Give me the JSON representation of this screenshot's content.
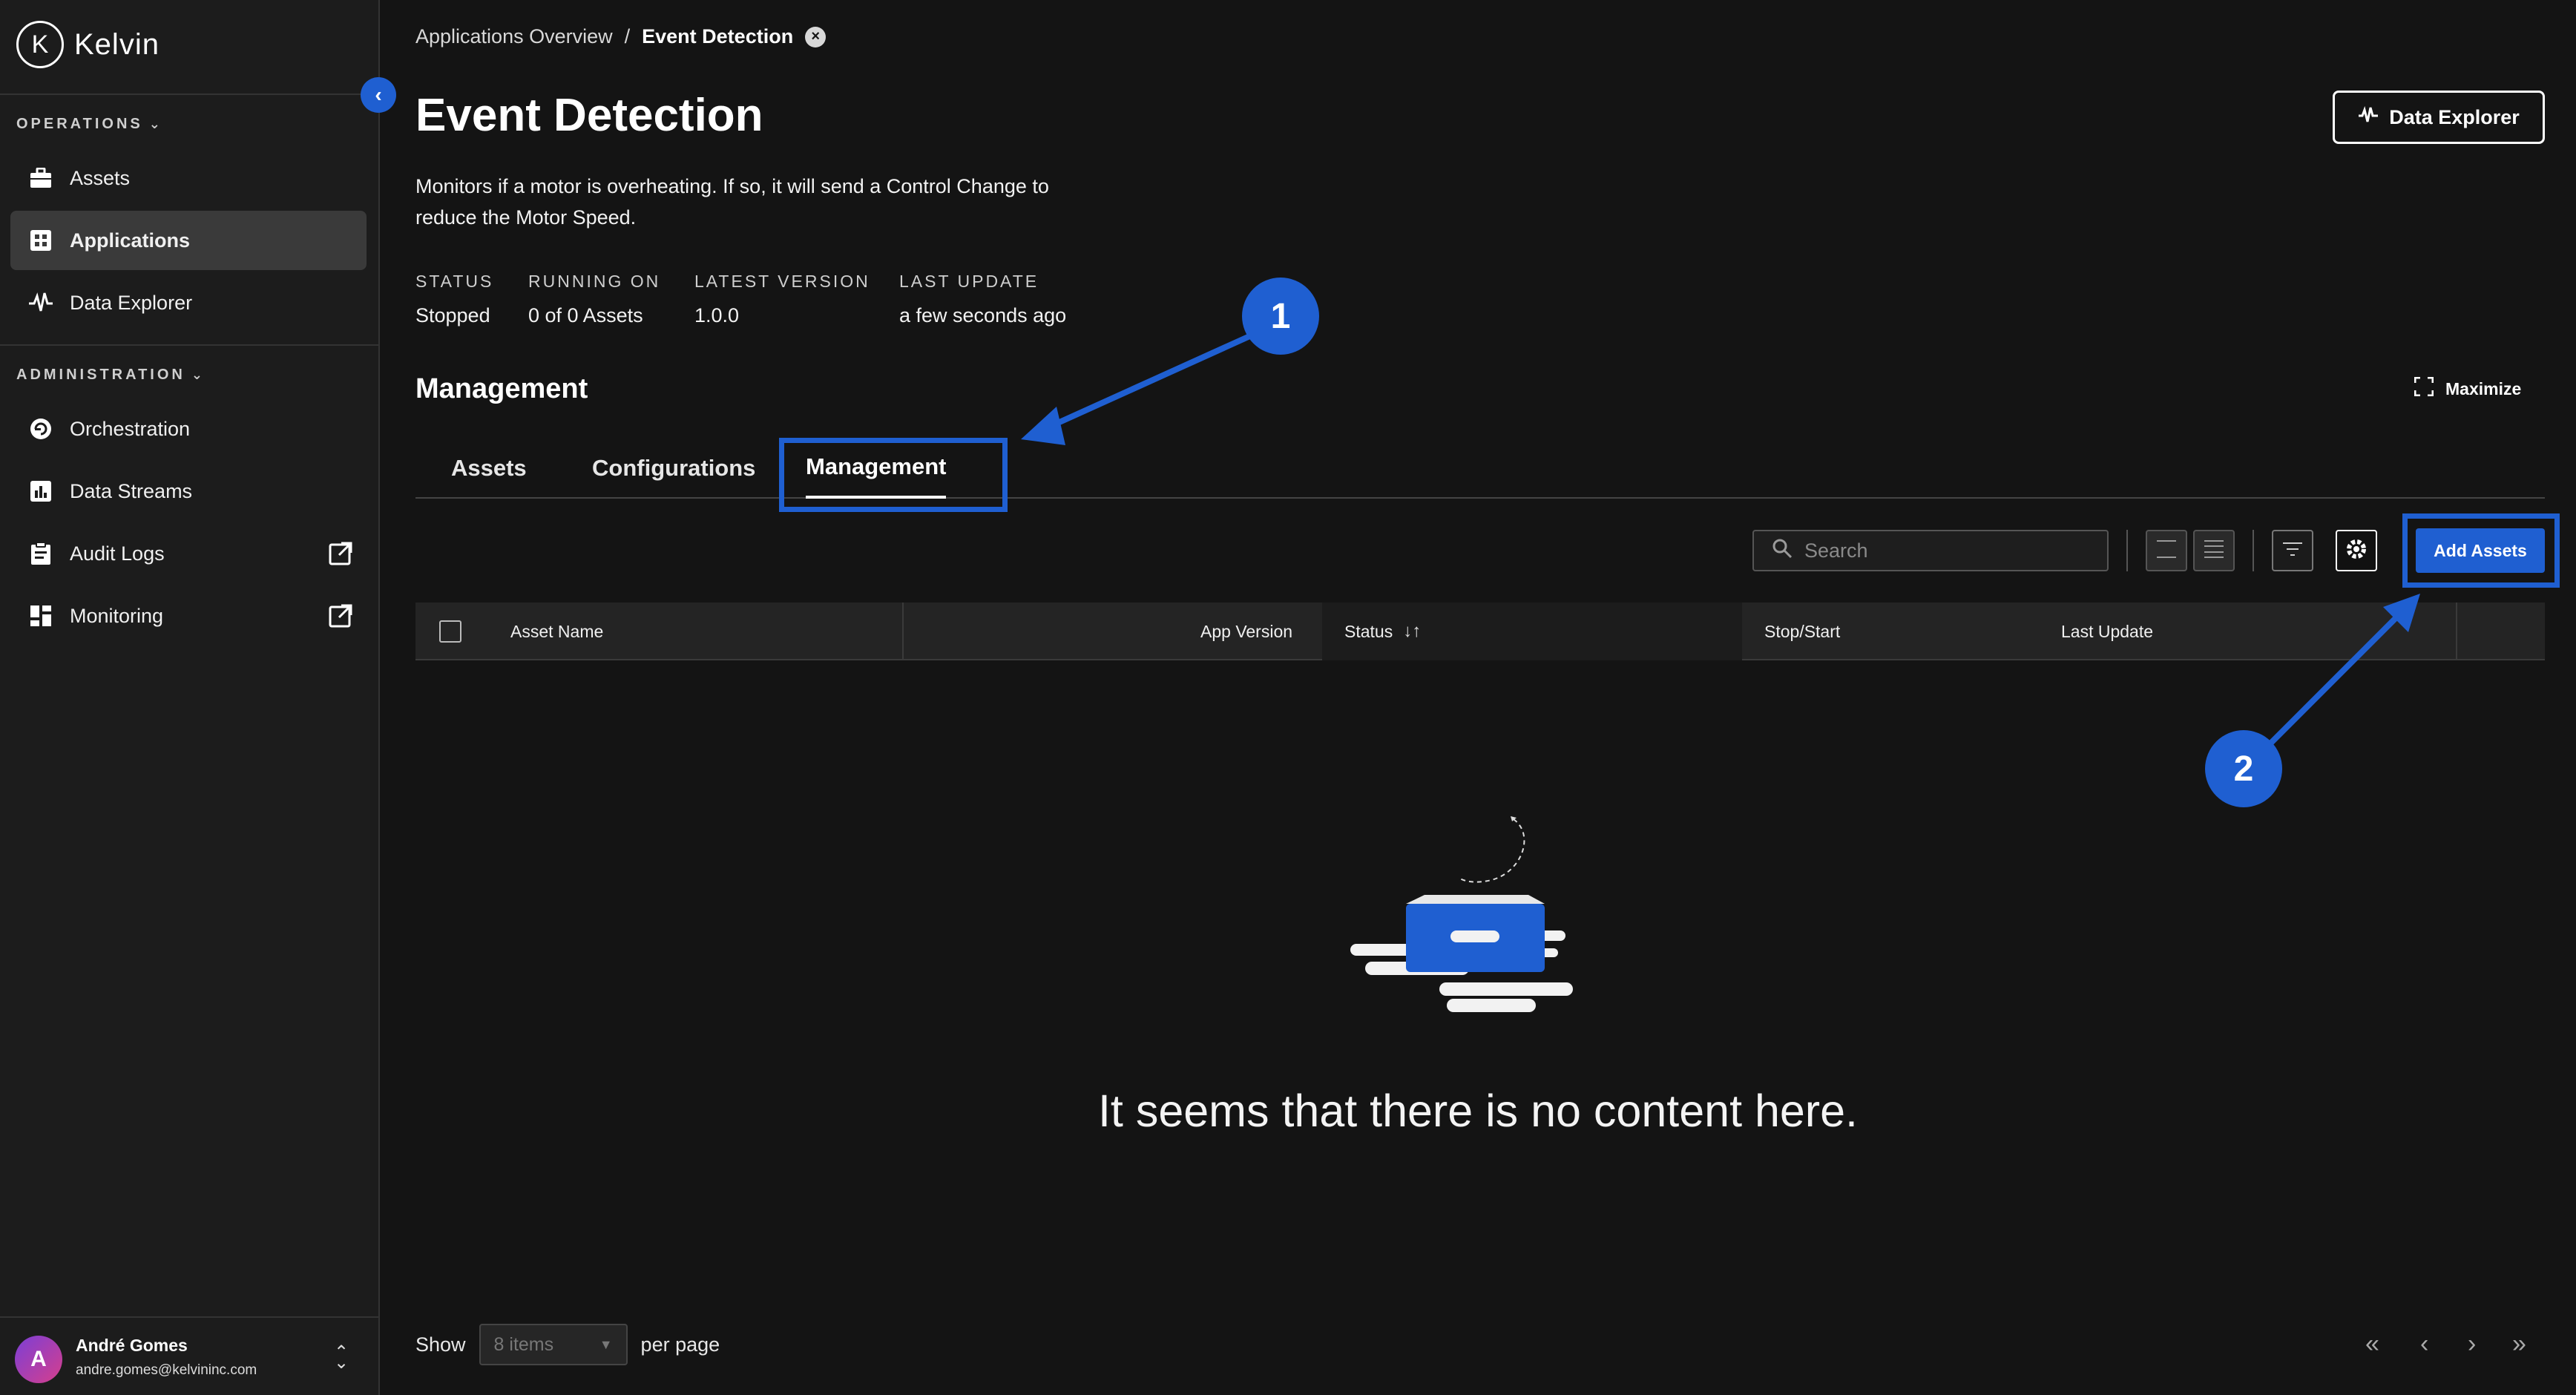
{
  "brand": {
    "name": "Kelvin",
    "mark": "K"
  },
  "sidebar": {
    "operations_title": "OPERATIONS",
    "operations_items": [
      {
        "label": "Assets",
        "icon": "briefcase-icon"
      },
      {
        "label": "Applications",
        "icon": "grid-icon",
        "active": true
      },
      {
        "label": "Data Explorer",
        "icon": "pulse-icon"
      }
    ],
    "administration_title": "ADMINISTRATION",
    "administration_items": [
      {
        "label": "Orchestration",
        "icon": "orchestration-icon"
      },
      {
        "label": "Data Streams",
        "icon": "bar-chart-icon"
      },
      {
        "label": "Audit Logs",
        "icon": "clipboard-icon",
        "external": true
      },
      {
        "label": "Monitoring",
        "icon": "dashboard-icon",
        "external": true
      }
    ]
  },
  "user": {
    "initial": "A",
    "name": "André Gomes",
    "email": "andre.gomes@kelvininc.com"
  },
  "breadcrumb": {
    "parent": "Applications Overview",
    "separator": "/",
    "current": "Event Detection"
  },
  "page": {
    "title": "Event Detection",
    "description": "Monitors if a motor is overheating. If so, it will send a Control Change to reduce the Motor Speed.",
    "data_explorer_label": "Data Explorer"
  },
  "meta": {
    "status_label": "STATUS",
    "status_value": "Stopped",
    "running_label": "RUNNING ON",
    "running_value": "0 of 0 Assets",
    "version_label": "LATEST VERSION",
    "version_value": "1.0.0",
    "update_label": "LAST UPDATE",
    "update_value": "a few seconds ago"
  },
  "management": {
    "title": "Management",
    "maximize_label": "Maximize",
    "tabs": [
      {
        "label": "Assets"
      },
      {
        "label": "Configurations"
      },
      {
        "label": "Management",
        "active": true
      }
    ]
  },
  "toolbar": {
    "search_placeholder": "Search",
    "add_assets_label": "Add Assets"
  },
  "table": {
    "columns": [
      "Asset Name",
      "App Version",
      "Status",
      "Stop/Start",
      "Last Update"
    ],
    "rows": []
  },
  "empty_state": {
    "message": "It seems that there is no content here."
  },
  "pagination": {
    "show_label": "Show",
    "per_page_value": "8 items",
    "per_page_label": "per page"
  },
  "annotations": {
    "callout_1": "1",
    "callout_2": "2"
  },
  "colors": {
    "accent": "#1f5fd1",
    "background": "#141414",
    "sidebar": "#1c1c1c"
  }
}
